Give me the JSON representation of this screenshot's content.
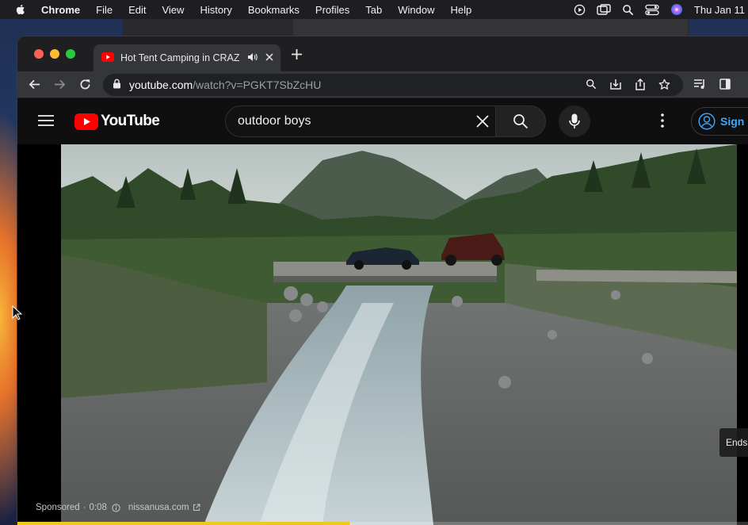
{
  "menubar": {
    "app": "Chrome",
    "items": [
      "File",
      "Edit",
      "View",
      "History",
      "Bookmarks",
      "Profiles",
      "Tab",
      "Window",
      "Help"
    ],
    "clock": "Thu Jan 11"
  },
  "tab": {
    "title": "Hot Tent Camping in CRAZ"
  },
  "address_bar": {
    "host": "youtube.com",
    "path": "/watch?v=PGKT7SbZcHU"
  },
  "youtube": {
    "logo_text": "YouTube",
    "search_value": "outdoor boys",
    "signin_label": "Sign in"
  },
  "player": {
    "ad_sponsored": "Sponsored",
    "ad_time": "0:08",
    "ad_domain": "nissanusa.com",
    "ends_label": "Ends",
    "progress_fraction": 0.45
  },
  "colors": {
    "yt_red": "#ff0000",
    "ad_progress": "#f2c71d",
    "link_blue": "#3ea6ff"
  }
}
